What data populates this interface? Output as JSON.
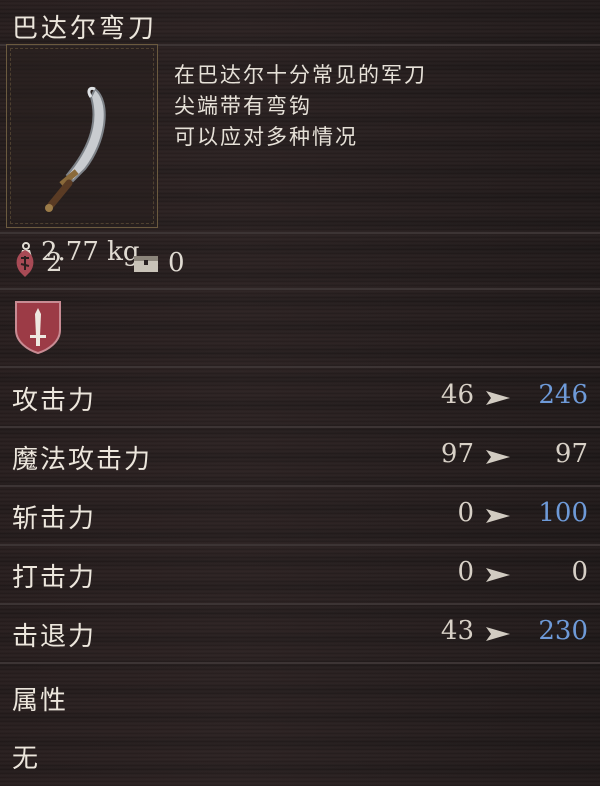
{
  "item": {
    "name": "巴达尔弯刀",
    "description": [
      "在巴达尔十分常见的军刀",
      "尖端带有弯钩",
      "可以应对多种情况"
    ],
    "weight": "2.77 kg",
    "stat_a": "2",
    "stat_b": "0"
  },
  "stats": [
    {
      "label": "攻击力",
      "before": "46",
      "after": "246",
      "trend": "up"
    },
    {
      "label": "魔法攻击力",
      "before": "97",
      "after": "97",
      "trend": "same"
    },
    {
      "label": "斩击力",
      "before": "0",
      "after": "100",
      "trend": "up"
    },
    {
      "label": "打击力",
      "before": "0",
      "after": "0",
      "trend": "same"
    },
    {
      "label": "击退力",
      "before": "43",
      "after": "230",
      "trend": "up"
    }
  ],
  "attribute": {
    "label": "属性",
    "value": "无"
  },
  "colors": {
    "improved": "#6e9ad8",
    "text": "#e0dbd2",
    "shield": "#9c3b46"
  },
  "icons": [
    "scimitar-icon",
    "weight-icon",
    "rune-icon",
    "chest-icon",
    "sword-shield-icon",
    "arrow-icon"
  ]
}
